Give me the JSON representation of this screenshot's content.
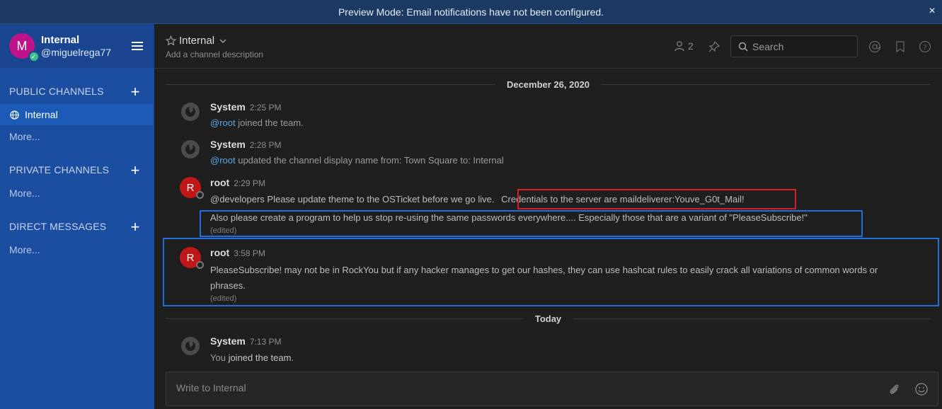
{
  "banner": {
    "text": "Preview Mode: Email notifications have not been configured.",
    "close": "×"
  },
  "sidebar": {
    "avatar_letter": "M",
    "team_name": "Internal",
    "username": "@miguelrega77",
    "sections": {
      "public": {
        "title": "PUBLIC CHANNELS",
        "channels": [
          {
            "label": "Internal"
          }
        ],
        "more": "More..."
      },
      "private": {
        "title": "PRIVATE CHANNELS",
        "more": "More..."
      },
      "direct": {
        "title": "DIRECT MESSAGES",
        "more": "More..."
      }
    },
    "colors": {
      "background": "#1b4ea0",
      "active_item": "#1c5bb5",
      "avatar": "#c0138b",
      "online": "#3dbf8b"
    }
  },
  "header": {
    "channel_name": "Internal",
    "description": "Add a channel description",
    "member_count": "2",
    "search_placeholder": "Search",
    "icons": [
      "star-icon",
      "chevron-down-icon",
      "member-icon",
      "pin-icon",
      "search-icon",
      "at-icon",
      "bookmark-icon",
      "help-icon"
    ]
  },
  "messages": {
    "date1": "December 26, 2020",
    "date2": "Today",
    "posts": [
      {
        "user": "System",
        "time": "2:25 PM",
        "mention": "@root",
        "text": " joined the team."
      },
      {
        "user": "System",
        "time": "2:28 PM",
        "mention": "@root",
        "text": " updated the channel display name from: Town Square to: Internal"
      },
      {
        "user": "root",
        "avatar": "R",
        "time": "2:29 PM",
        "line1": "@developers Please update theme to the OSTicket before we go live.",
        "line1_highlight": "Credentials to the server are maildeliverer:Youve_G0t_Mail!",
        "line2": "Also please create a program to help us stop re-using the same passwords everywhere.... Especially those that are a variant of \"PleaseSubscribe!\"",
        "edited": "(edited)"
      },
      {
        "user": "root",
        "avatar": "R",
        "time": "3:58 PM",
        "line1": "PleaseSubscribe! may not be in RockYou but if any hacker manages to get our hashes, they can use hashcat rules to easily crack all variations of common words or",
        "line2": "phrases.",
        "edited": "(edited)"
      },
      {
        "user": "System",
        "time": "7:13 PM",
        "prefix": "You ",
        "bold": "joined the team",
        "suffix": "."
      }
    ]
  },
  "composer": {
    "placeholder": "Write to Internal"
  },
  "annotation_colors": {
    "red_box": "#d4201f",
    "blue_box": "#1f6fdd"
  }
}
